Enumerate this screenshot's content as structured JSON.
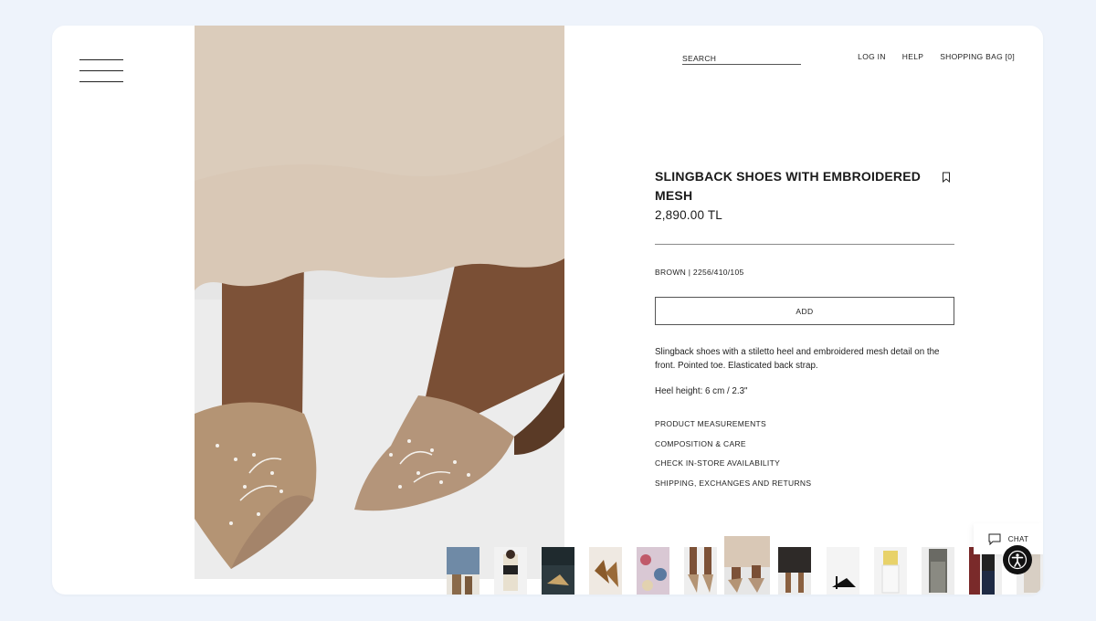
{
  "nav": {
    "search_placeholder": "SEARCH",
    "login": "LOG IN",
    "help": "HELP",
    "bag": "SHOPPING BAG [0]"
  },
  "product": {
    "title": "SLINGBACK SHOES WITH EMBROIDERED MESH",
    "price": "2,890.00 TL",
    "color_ref": "BROWN | 2256/410/105",
    "add_label": "ADD",
    "description": "Slingback shoes with a stiletto heel and embroidered mesh detail on the front. Pointed toe. Elasticated back strap.",
    "heel_height": "Heel height: 6 cm / 2.3\"",
    "links": [
      "PRODUCT MEASUREMENTS",
      "COMPOSITION & CARE",
      "CHECK IN-STORE AVAILABILITY",
      "SHIPPING, EXCHANGES AND RETURNS"
    ]
  },
  "widgets": {
    "chat_label": "CHAT"
  },
  "icons": {
    "menu": "hamburger-menu-icon",
    "bookmark": "bookmark-icon",
    "chat": "chat-bubble-icon",
    "accessibility": "accessibility-icon"
  },
  "thumbnails_count": 13,
  "active_thumbnail": 6
}
